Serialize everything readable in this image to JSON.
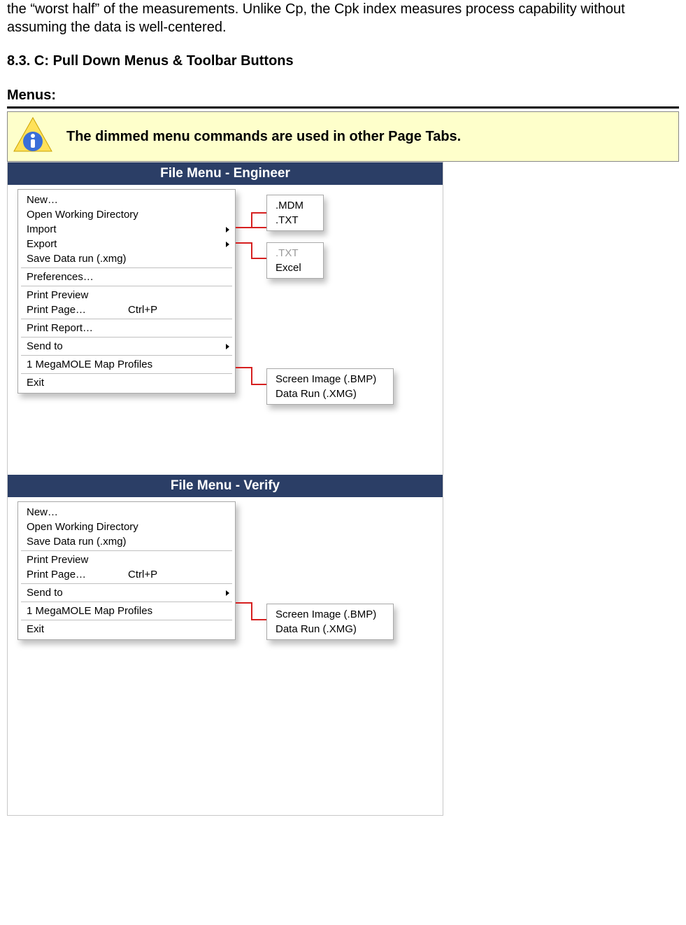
{
  "intro_text": "the “worst half” of the measurements.   Unlike Cp, the Cpk index measures process capability without assuming the data is well-centered.",
  "section_heading": "8.3. C: Pull Down Menus & Toolbar Buttons",
  "menus_label": "Menus:",
  "note_text": "The dimmed menu commands are used in other Page Tabs.",
  "engineer": {
    "title": "File Menu - Engineer",
    "items": {
      "new": "New…",
      "open_wd": "Open Working Directory",
      "import": "Import",
      "export": "Export",
      "save": "Save Data run (.xmg)",
      "prefs": "Preferences…",
      "print_preview": "Print Preview",
      "print_page": "Print Page…",
      "print_page_shortcut": "Ctrl+P",
      "print_report": "Print Report…",
      "send_to": "Send to",
      "profiles": "1 MegaMOLE Map Profiles",
      "exit": "Exit"
    },
    "import_sub": {
      "mdm": ".MDM",
      "txt": ".TXT"
    },
    "export_sub": {
      "txt": ".TXT",
      "excel": "Excel"
    },
    "sendto_sub": {
      "bmp": "Screen Image (.BMP)",
      "xmg": "Data Run (.XMG)"
    }
  },
  "verify": {
    "title": "File Menu - Verify",
    "items": {
      "new": "New…",
      "open_wd": "Open Working Directory",
      "save": "Save Data run (.xmg)",
      "print_preview": "Print Preview",
      "print_page": "Print Page…",
      "print_page_shortcut": "Ctrl+P",
      "send_to": "Send to",
      "profiles": "1 MegaMOLE Map Profiles",
      "exit": "Exit"
    },
    "sendto_sub": {
      "bmp": "Screen Image (.BMP)",
      "xmg": "Data Run (.XMG)"
    }
  }
}
